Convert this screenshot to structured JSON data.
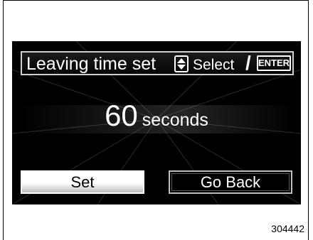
{
  "header": {
    "title": "Leaving time set",
    "select_label": "Select",
    "separator": "/",
    "enter_key": "ENTER"
  },
  "value": {
    "number": "60",
    "unit": "seconds"
  },
  "buttons": {
    "set": "Set",
    "go_back": "Go Back"
  },
  "figure_id": "304442",
  "icons": {
    "updown": "up-down-arrow-icon"
  }
}
